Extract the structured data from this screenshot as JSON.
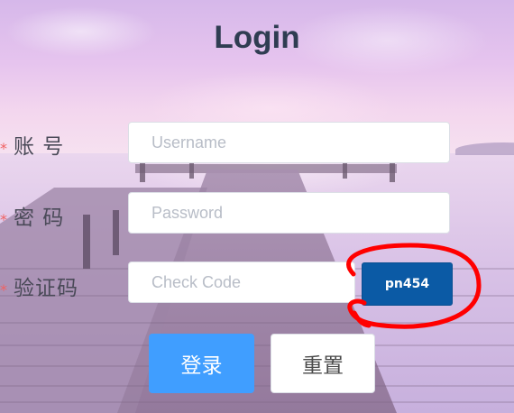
{
  "page": {
    "title": "Login"
  },
  "form": {
    "username": {
      "label": "账 号",
      "required_mark": "*",
      "placeholder": "Username",
      "value": ""
    },
    "password": {
      "label": "密 码",
      "required_mark": "*",
      "placeholder": "Password",
      "value": ""
    },
    "check_code": {
      "label": "验证码",
      "required_mark": "*",
      "placeholder": "Check Code",
      "value": "",
      "code_text": "pn454"
    }
  },
  "buttons": {
    "login_label": "登录",
    "reset_label": "重置"
  },
  "colors": {
    "title": "#2f3d52",
    "login_button": "#409eff",
    "code_button": "#0b5aa5",
    "annotation_circle": "#ff0000"
  }
}
